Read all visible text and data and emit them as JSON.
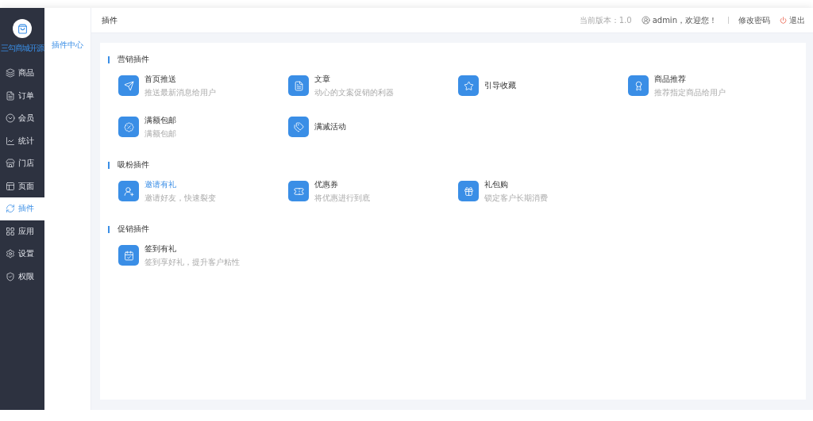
{
  "sidebar": {
    "logo_text": "三勾商城开源",
    "items": [
      {
        "label": "商品",
        "selected": false
      },
      {
        "label": "订单",
        "selected": false
      },
      {
        "label": "会员",
        "selected": false
      },
      {
        "label": "统计",
        "selected": false
      },
      {
        "label": "门店",
        "selected": false
      },
      {
        "label": "页面",
        "selected": false
      },
      {
        "label": "插件",
        "selected": true
      },
      {
        "label": "应用",
        "selected": false
      },
      {
        "label": "设置",
        "selected": false
      },
      {
        "label": "权限",
        "selected": false
      }
    ]
  },
  "submenu": {
    "items": [
      {
        "label": "插件中心",
        "selected": true
      }
    ]
  },
  "header": {
    "title": "插件",
    "version": "当前版本：1.0",
    "user": "admin，欢迎您！",
    "change_password": "修改密码",
    "logout": "退出"
  },
  "sections": [
    {
      "title": "营销插件",
      "plugins": [
        {
          "name": "首页推送",
          "description": "推送最新消息给用户",
          "selected": false
        },
        {
          "name": "文章",
          "description": "动心的文案促销的利器",
          "selected": false
        },
        {
          "name": "引导收藏",
          "selected": false
        },
        {
          "name": "商品推荐",
          "description": "推荐指定商品给用户",
          "selected": false
        },
        {
          "name": "满额包邮",
          "description": "满额包邮",
          "selected": false
        },
        {
          "name": "满减活动",
          "selected": false
        }
      ]
    },
    {
      "title": "吸粉插件",
      "plugins": [
        {
          "name": "邀请有礼",
          "description": "邀请好友，快速裂变",
          "selected": true
        },
        {
          "name": "优惠券",
          "description": "将优惠进行到底",
          "selected": false
        },
        {
          "name": "礼包购",
          "description": "锁定客户长期消费",
          "selected": false
        }
      ]
    },
    {
      "title": "促销插件",
      "plugins": [
        {
          "name": "签到有礼",
          "description": "签到享好礼，提升客户粘性",
          "selected": false
        }
      ]
    }
  ]
}
